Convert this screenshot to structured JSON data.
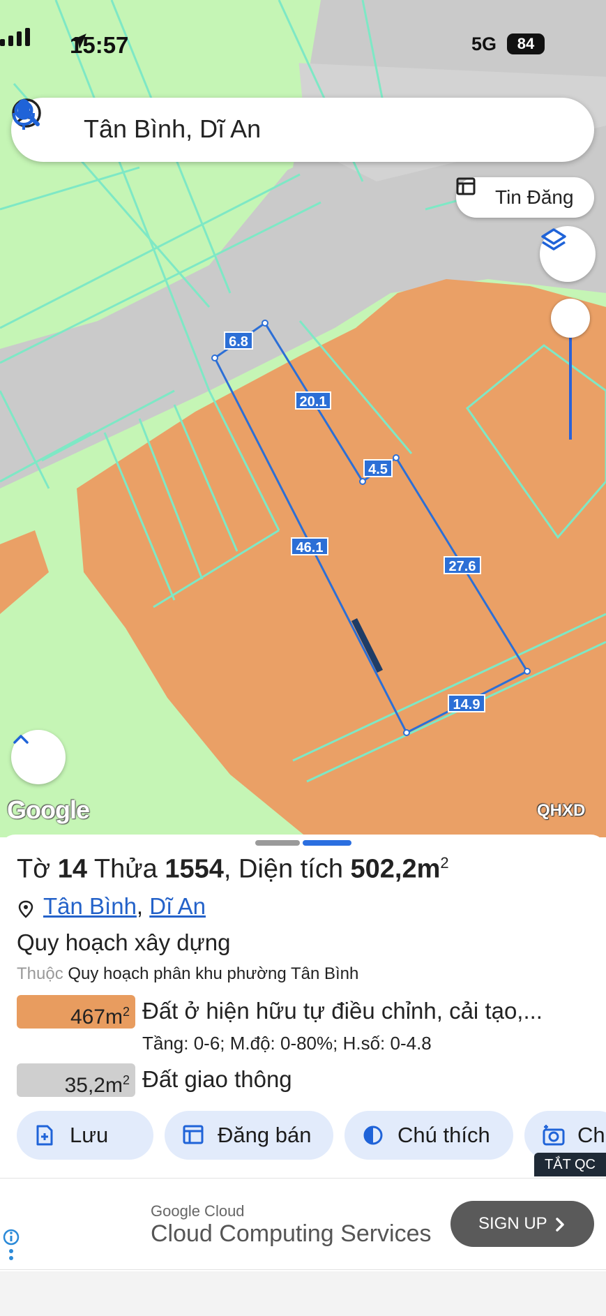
{
  "status_bar": {
    "time": "15:57",
    "network": "5G",
    "battery": "84"
  },
  "search": {
    "query": "Tân Bình, Dĩ An"
  },
  "buttons": {
    "tin_dang": "Tin Đăng"
  },
  "map": {
    "google_logo": "Google",
    "layer_label": "QHXD",
    "dimension_labels": [
      "6.8",
      "20.1",
      "4.5",
      "46.1",
      "27.6",
      "14.9"
    ]
  },
  "info": {
    "title_prefix": "Tờ",
    "sheet_no": "14",
    "plot_word": "Thửa",
    "plot_no": "1554",
    "area_label": ", Diện tích",
    "area_value": "502,2m",
    "area_unit_sup": "2",
    "location": {
      "ward": "Tân Bình",
      "separator": ",",
      "city": "Dĩ An"
    },
    "section_title": "Quy hoạch xây dựng",
    "belongs_label": "Thuộc",
    "belongs_value": "Quy hoạch phân khu phường Tân Bình",
    "zones": [
      {
        "area": "467m",
        "sup": "2",
        "color": "#e89c5f",
        "name": "Đất ở hiện hữu tự điều chỉnh, cải tạo,...",
        "details": "Tầng: 0-6; M.độ: 0-80%; H.số: 0-4.8"
      },
      {
        "area": "35,2m",
        "sup": "2",
        "color": "#cfcfcf",
        "name": "Đất giao thông"
      }
    ]
  },
  "actions": [
    "Lưu",
    "Đăng bán",
    "Chú thích",
    "Ch"
  ],
  "ad": {
    "close_label": "TẮT QC",
    "brand": "Google Cloud",
    "headline": "Cloud Computing Services",
    "cta": "SIGN UP"
  },
  "colors": {
    "accent": "#2b6fe0",
    "residential": "#e89c5f",
    "green_zone": "#c5f5b5",
    "road": "#c8c8c8"
  }
}
